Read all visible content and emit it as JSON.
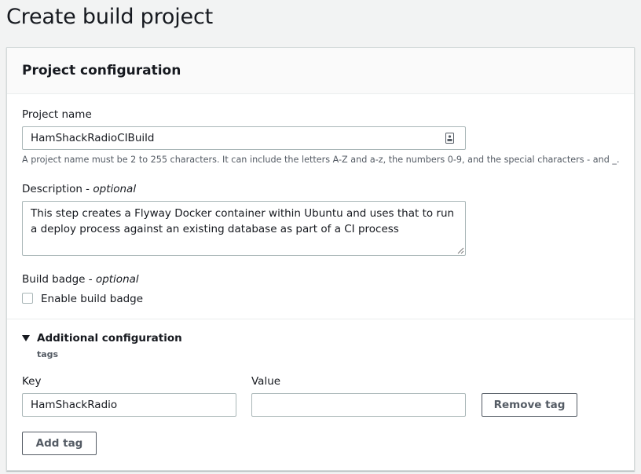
{
  "page": {
    "title": "Create build project"
  },
  "panel": {
    "title": "Project configuration",
    "project_name": {
      "label": "Project name",
      "value": "HamShackRadioCIBuild",
      "hint": "A project name must be 2 to 255 characters. It can include the letters A-Z and a-z, the numbers 0-9, and the special characters - and _."
    },
    "description": {
      "label": "Description",
      "optional": "optional",
      "value": "This step creates a Flyway Docker container within Ubuntu and uses that to run a deploy process against an existing database as part of a CI process"
    },
    "build_badge": {
      "label": "Build badge",
      "optional": "optional",
      "checkbox_label": "Enable build badge",
      "checked": false
    },
    "additional": {
      "title": "Additional configuration",
      "subtitle": "tags",
      "key_label": "Key",
      "value_label": "Value",
      "key_value": "HamShackRadio",
      "value_value": "",
      "remove_tag": "Remove tag",
      "add_tag": "Add tag"
    }
  }
}
